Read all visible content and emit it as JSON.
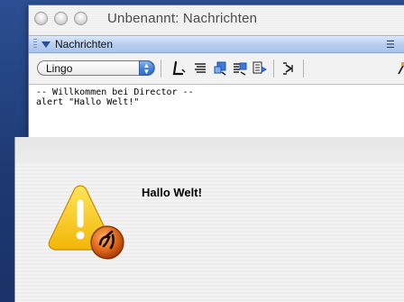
{
  "window": {
    "title": "Unbenannt: Nachrichten",
    "panel_title": "Nachrichten"
  },
  "toolbar": {
    "language_select": "Lingo",
    "icons": [
      "lingo-l-icon",
      "script-lines-icon",
      "cast-member-icon",
      "sprite-list-icon",
      "properties-icon",
      "step-script-icon",
      "watcher-icon"
    ]
  },
  "message_area": {
    "lines": [
      "-- Willkommen bei Director --",
      "alert \"Hallo Welt!\""
    ]
  },
  "alert": {
    "message": "Hallo Welt!",
    "icon": "director-warning-icon"
  },
  "colors": {
    "desktop": "#1f3d78",
    "panel_bar": "#b9cff0",
    "select_arrows": "#3e7fd9",
    "warning_yellow": "#f6c915",
    "director_orange": "#e0681b"
  }
}
